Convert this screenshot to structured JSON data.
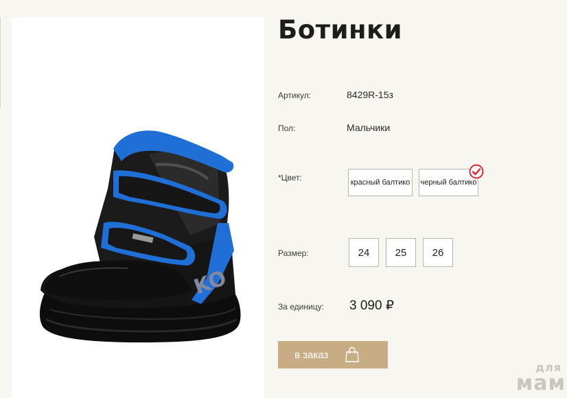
{
  "product": {
    "title": "Ботинки",
    "article": {
      "label": "Артикул:",
      "value": "8429R-15з"
    },
    "gender": {
      "label": "Пол:",
      "value": "Мальчики"
    },
    "color": {
      "label": "*Цвет:",
      "options": [
        "красный балтико",
        "черный балтико"
      ],
      "selected": "черный балтико"
    },
    "size": {
      "label": "Размер:",
      "options": [
        "24",
        "25",
        "26"
      ]
    },
    "price": {
      "label": "За единицу:",
      "value": "3 090 ₽"
    },
    "order_button": {
      "label": "в заказ"
    },
    "image": {
      "boot_text": "KO"
    }
  },
  "watermark": {
    "line1": "для",
    "line2": "мам"
  },
  "colors": {
    "background": "#f8f6f0",
    "button": "#c8ad84",
    "check": "#e0262c",
    "boot_blue": "#1f6fd6",
    "boot_black": "#111111"
  },
  "icons": {
    "selected_check": "check-circle-icon",
    "order": "shopping-bag-icon"
  }
}
